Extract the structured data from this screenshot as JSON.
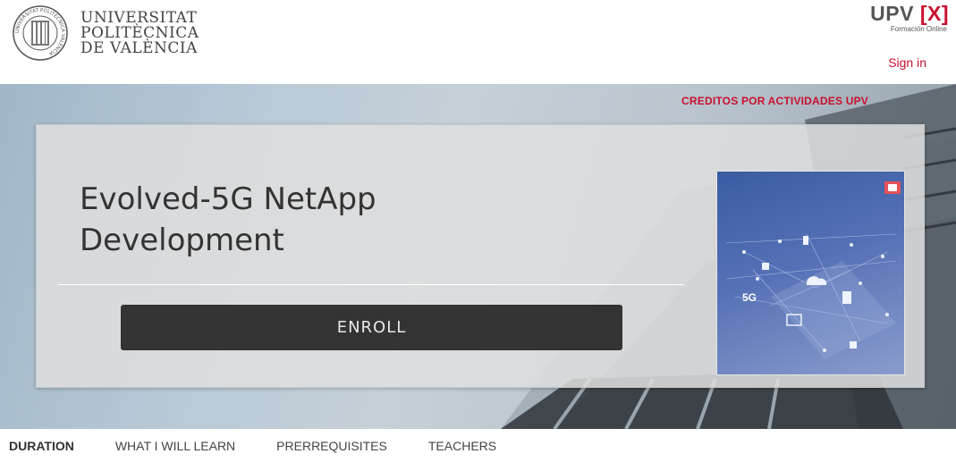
{
  "header": {
    "logo_lines": [
      "UNIVERSITAT",
      "POLITÈCNICA",
      "DE VALÈNCIA"
    ],
    "seal_text": "UNIVERSITAT POLITÈCNICA VALÈNCIA",
    "brand_main": "UPV",
    "brand_x": "[X]",
    "brand_sub": "Formación Online",
    "signin_label": "Sign in"
  },
  "hero": {
    "credits_label": "CREDITOS POR ACTIVIDADES UPV",
    "title": "Evolved-5G NetApp Development",
    "enroll_label": "ENROLL",
    "image_label": "5G"
  },
  "tabs": [
    {
      "label": "DURATION",
      "active": true
    },
    {
      "label": "WHAT I WILL LEARN",
      "active": false
    },
    {
      "label": "PRERREQUISITES",
      "active": false
    },
    {
      "label": "TEACHERS",
      "active": false
    }
  ],
  "colors": {
    "accent": "#c8102e",
    "button": "#333333"
  }
}
